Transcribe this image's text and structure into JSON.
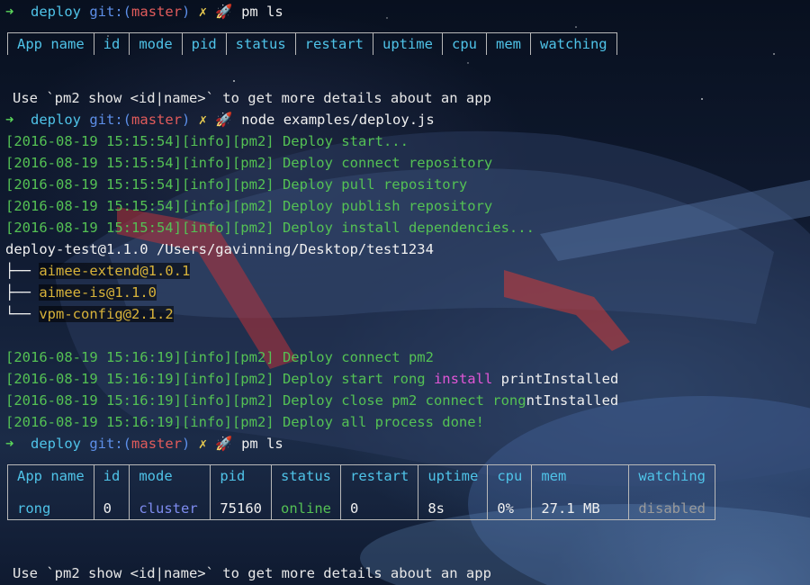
{
  "prompt": {
    "arrow": "➜",
    "dir": "deploy",
    "git_label": "git:(",
    "branch": "master",
    "git_close": ")",
    "dirty": "✗",
    "rocket": "🚀"
  },
  "commands": {
    "cmd1": "pm ls",
    "cmd2": "node examples/deploy.js",
    "cmd3": "pm ls"
  },
  "table1": {
    "headers": [
      "App name",
      "id",
      "mode",
      "pid",
      "status",
      "restart",
      "uptime",
      "cpu",
      "mem",
      "watching"
    ]
  },
  "hint": "Use `pm2 show <id|name>` to get more details about an app",
  "log_block1": [
    {
      "prefix": "[2016-08-19 15:15:54][info][pm2]",
      "text": "Deploy start..."
    },
    {
      "prefix": "[2016-08-19 15:15:54][info][pm2]",
      "text": "Deploy connect repository"
    },
    {
      "prefix": "[2016-08-19 15:15:54][info][pm2]",
      "text": "Deploy pull repository"
    },
    {
      "prefix": "[2016-08-19 15:15:54][info][pm2]",
      "text": "Deploy publish repository"
    },
    {
      "prefix": "[2016-08-19 15:15:54][info][pm2]",
      "text": "Deploy install dependencies..."
    }
  ],
  "package_line": "deploy-test@1.1.0 /Users/gavinning/Desktop/test1234",
  "deps": [
    {
      "branch": "├──",
      "name": "aimee-extend@1.0.1"
    },
    {
      "branch": "├──",
      "name": "aimee-is@1.1.0"
    },
    {
      "branch": "└──",
      "name": "vpm-config@2.1.2"
    }
  ],
  "log_block2": {
    "l1": {
      "prefix": "[2016-08-19 15:16:19][info][pm2]",
      "text": "Deploy connect pm2"
    },
    "l2": {
      "prefix": "[2016-08-19 15:16:19][info][pm2]",
      "text_a": "Deploy start rong",
      "text_b": "install",
      "text_c": "printInstalled"
    },
    "l3": {
      "prefix": "[2016-08-19 15:16:19][info][pm2]",
      "text_a": "Deploy close pm2 connect rong",
      "text_b": "ntInstalled"
    },
    "l4": {
      "prefix": "[2016-08-19 15:16:19][info][pm2]",
      "text": "Deploy all process done!"
    }
  },
  "table2": {
    "headers": [
      "App name",
      "id",
      "mode",
      "pid",
      "status",
      "restart",
      "uptime",
      "cpu",
      "mem",
      "watching"
    ],
    "row": {
      "app": "rong",
      "id": "0",
      "mode": "cluster",
      "pid": "75160",
      "status": "online",
      "restart": "0",
      "uptime": "8s",
      "cpu": "0%",
      "mem": "27.1 MB",
      "watching": "disabled"
    }
  },
  "colors": {
    "prompt_arrow": "#5ad45a",
    "dir": "#4fc3e8",
    "branch": "#e05b5b",
    "log_green": "#54c154",
    "install_magenta": "#e056d6",
    "dep_yellow": "#d8b33a",
    "table_header": "#4fc3e8",
    "mode_purple": "#7e8cf0"
  }
}
